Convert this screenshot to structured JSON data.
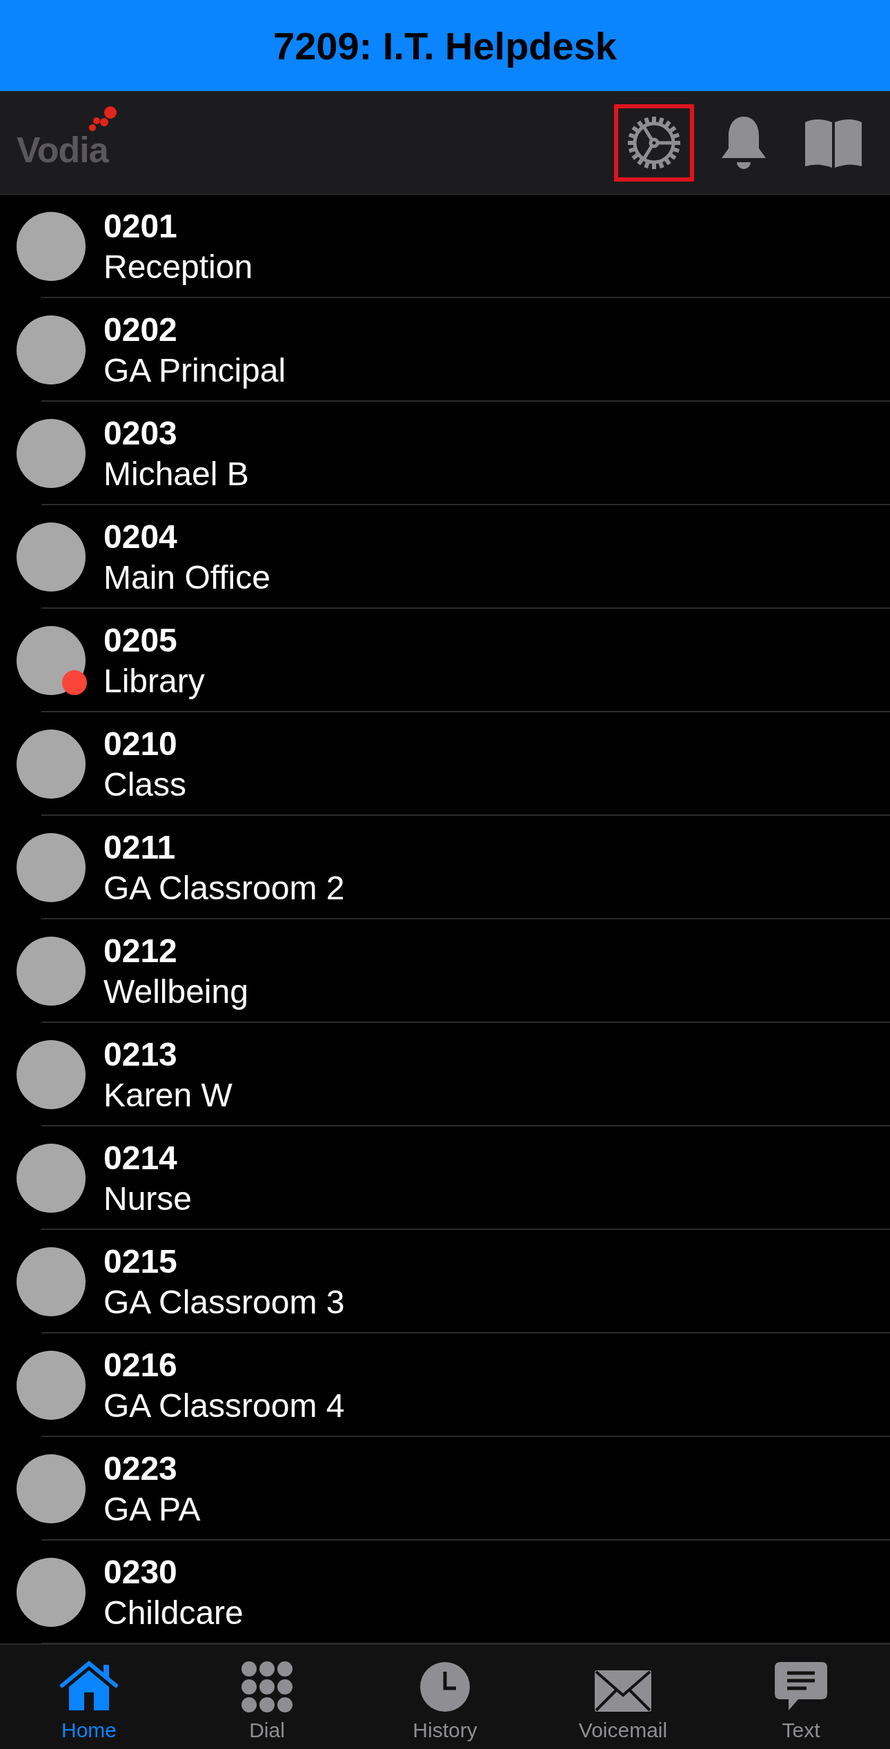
{
  "header": {
    "title": "7209: I.T. Helpdesk"
  },
  "toolbar": {
    "logo": "Vodia",
    "actions": [
      {
        "kind": "settings",
        "highlighted": true
      },
      {
        "kind": "notifications",
        "highlighted": false
      },
      {
        "kind": "directory",
        "highlighted": false
      }
    ]
  },
  "contacts": [
    {
      "number": "0201",
      "name": "Reception",
      "busy": false
    },
    {
      "number": "0202",
      "name": "GA Principal",
      "busy": false
    },
    {
      "number": "0203",
      "name": "Michael B",
      "busy": false
    },
    {
      "number": "0204",
      "name": "Main Office",
      "busy": false
    },
    {
      "number": "0205",
      "name": "Library",
      "busy": true
    },
    {
      "number": "0210",
      "name": "Class",
      "busy": false
    },
    {
      "number": "0211",
      "name": "GA Classroom 2",
      "busy": false
    },
    {
      "number": "0212",
      "name": "Wellbeing",
      "busy": false
    },
    {
      "number": "0213",
      "name": "Karen W",
      "busy": false
    },
    {
      "number": "0214",
      "name": "Nurse",
      "busy": false
    },
    {
      "number": "0215",
      "name": "GA Classroom 3",
      "busy": false
    },
    {
      "number": "0216",
      "name": "GA Classroom 4",
      "busy": false
    },
    {
      "number": "0223",
      "name": "GA PA",
      "busy": false
    },
    {
      "number": "0230",
      "name": "Childcare",
      "busy": false
    }
  ],
  "tab_bar": [
    {
      "kind": "home",
      "label": "Home",
      "selected": true
    },
    {
      "kind": "dial",
      "label": "Dial",
      "selected": false
    },
    {
      "kind": "history",
      "label": "History",
      "selected": false
    },
    {
      "kind": "voicemail",
      "label": "Voicemail",
      "selected": false
    },
    {
      "kind": "text",
      "label": "Text",
      "selected": false
    }
  ]
}
